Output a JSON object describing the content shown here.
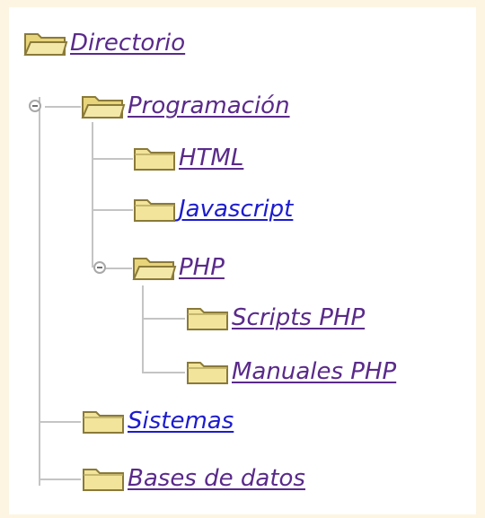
{
  "tree": {
    "root": {
      "label": "Directorio",
      "icon": "folder-open-icon",
      "state": "visited"
    },
    "items": [
      {
        "id": "programacion",
        "label": "Programación",
        "icon": "folder-open-icon",
        "state": "visited",
        "expanded": true
      },
      {
        "id": "html",
        "label": "HTML",
        "icon": "folder-closed-icon",
        "state": "visited"
      },
      {
        "id": "javascript",
        "label": "Javascript",
        "icon": "folder-closed-icon",
        "state": "unvisited"
      },
      {
        "id": "php",
        "label": "PHP",
        "icon": "folder-open-icon",
        "state": "visited",
        "expanded": true
      },
      {
        "id": "scripts-php",
        "label": "Scripts PHP",
        "icon": "folder-closed-icon",
        "state": "visited"
      },
      {
        "id": "manuales-php",
        "label": "Manuales PHP",
        "icon": "folder-closed-icon",
        "state": "visited"
      },
      {
        "id": "sistemas",
        "label": "Sistemas",
        "icon": "folder-closed-icon",
        "state": "unvisited"
      },
      {
        "id": "bases-de-datos",
        "label": "Bases de datos",
        "icon": "folder-closed-icon",
        "state": "visited"
      }
    ]
  },
  "colors": {
    "visited_link": "#5a2a8a",
    "unvisited_link": "#1c1ccf",
    "folder_fill": "#f2e49a",
    "folder_edge": "#8a7a3a",
    "page_background": "#fdf5e2",
    "panel_background": "#ffffff",
    "tree_line": "#c4c4c4"
  }
}
